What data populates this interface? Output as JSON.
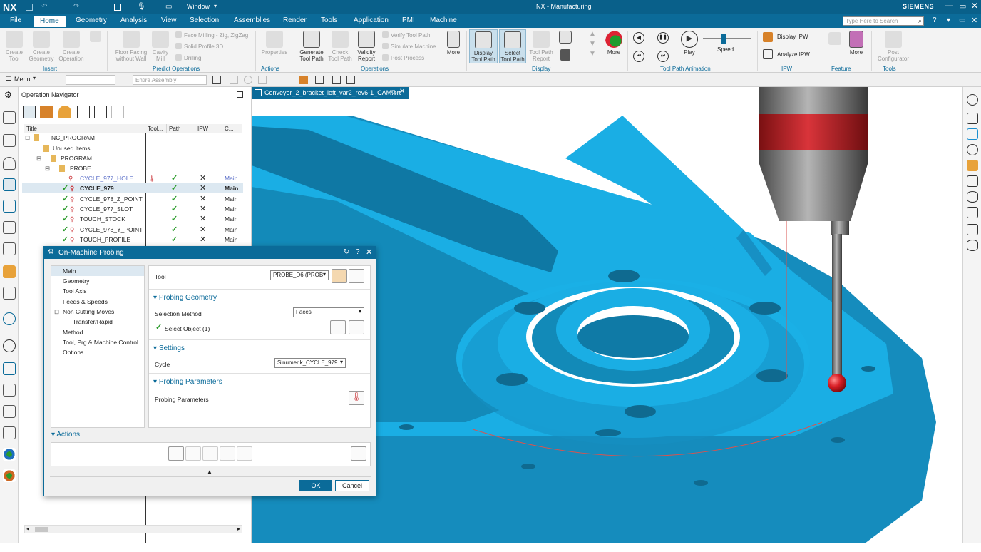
{
  "app": {
    "logo": "NX",
    "window_menu": "Window",
    "title": "NX - Manufacturing",
    "brand": "SIEMENS",
    "search_placeholder": "Type Here to Search"
  },
  "tabs": [
    "File",
    "Home",
    "Geometry",
    "Analysis",
    "View",
    "Selection",
    "Assemblies",
    "Render",
    "Tools",
    "Application",
    "PMI",
    "Machine"
  ],
  "ribbon": {
    "insert": {
      "create_tool": "Create Tool",
      "create_geometry": "Create Geometry",
      "create_operation": "Create Operation",
      "group": "Insert"
    },
    "predict": {
      "floor_facing": "Floor Facing without Wall",
      "cavity_mill": "Cavity Mill",
      "face_milling": "Face Milling - Zig, ZigZag",
      "solid_profile": "Solid Profile 3D",
      "drilling": "Drilling",
      "group": "Predict Operations"
    },
    "actions": {
      "properties": "Properties",
      "group": "Actions"
    },
    "operations": {
      "generate": "Generate Tool Path",
      "check": "Check Tool Path",
      "validity": "Validity Report",
      "verify": "Verify Tool Path",
      "simulate": "Simulate Machine",
      "post": "Post Process",
      "more": "More",
      "group": "Operations"
    },
    "display": {
      "display_tp": "Display Tool Path",
      "select_tp": "Select Tool Path",
      "tp_report": "Tool Path Report",
      "more": "More",
      "group": "Display"
    },
    "animation": {
      "play": "Play",
      "speed": "Speed",
      "group": "Tool Path Animation"
    },
    "ipw": {
      "display_ipw": "Display IPW",
      "analyze_ipw": "Analyze IPW",
      "group": "IPW"
    },
    "feature": {
      "more": "More",
      "group": "Feature"
    },
    "tools": {
      "post_config": "Post Configurator",
      "group": "Tools"
    }
  },
  "selbar": {
    "menu": "Menu",
    "filter": "Entire Assembly"
  },
  "navigator": {
    "title": "Operation Navigator",
    "columns": [
      "Title",
      "Tool...",
      "Path",
      "IPW",
      "C..."
    ],
    "rows": [
      {
        "name": "NC_PROGRAM"
      },
      {
        "name": "Unused Items"
      },
      {
        "name": "PROGRAM"
      },
      {
        "name": "PROBE"
      },
      {
        "name": "CYCLE_977_HOLE",
        "ck": "Main"
      },
      {
        "name": "CYCLE_979",
        "ck": "Main"
      },
      {
        "name": "CYCLE_978_Z_POINT",
        "ck": "Main"
      },
      {
        "name": "CYCLE_977_SLOT",
        "ck": "Main"
      },
      {
        "name": "TOUCH_STOCK",
        "ck": "Main"
      },
      {
        "name": "CYCLE_978_Y_POINT",
        "ck": "Main"
      },
      {
        "name": "TOUCH_PROFILE",
        "ck": "Main"
      }
    ]
  },
  "viewport_tab": "Conveyer_2_bracket_left_var2_rev6-1_CAM.prt",
  "dialog": {
    "title": "On-Machine Probing",
    "tree": [
      "Main",
      "Geometry",
      "Tool Axis",
      "Feeds & Speeds",
      "Non Cutting Moves",
      "Transfer/Rapid",
      "Method",
      "Tool, Prg & Machine Control",
      "Options"
    ],
    "tool_label": "Tool",
    "tool_value": "PROBE_D6 (PROB",
    "probing_geometry": "Probing Geometry",
    "selection_method_label": "Selection Method",
    "selection_method_value": "Faces",
    "select_object": "Select Object (1)",
    "settings": "Settings",
    "cycle_label": "Cycle",
    "cycle_value": "Sinumerik_CYCLE_979",
    "probing_parameters": "Probing Parameters",
    "probing_parameters_label": "Probing Parameters",
    "actions": "Actions",
    "ok": "OK",
    "cancel": "Cancel"
  },
  "colors": {
    "accent": "#0b6b99",
    "part": "#1aaee4",
    "probe_red": "#c71d23"
  }
}
